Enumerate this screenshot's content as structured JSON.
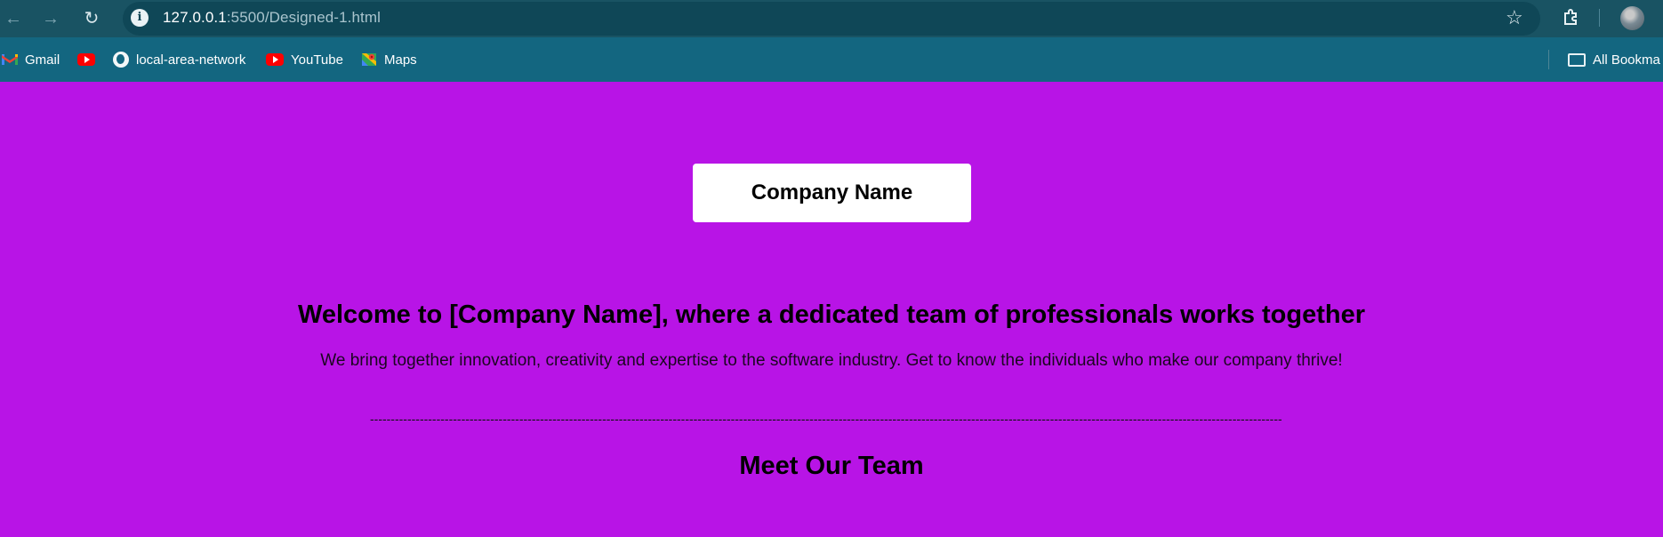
{
  "browser": {
    "url_host": "127.0.0.1",
    "url_path": ":5500/Designed-1.html",
    "nav": {
      "back_icon": "arrow-left-icon",
      "forward_icon": "arrow-right-icon",
      "reload_icon": "reload-icon"
    }
  },
  "bookmarks": {
    "items": [
      {
        "label": "Gmail",
        "icon": "gmail-icon"
      },
      {
        "label": "",
        "icon": "youtube-icon"
      },
      {
        "label": "local-area-network",
        "icon": "globe-icon"
      },
      {
        "label": "YouTube",
        "icon": "youtube-icon"
      },
      {
        "label": "Maps",
        "icon": "maps-icon"
      }
    ],
    "all_bookmarks": "All Bookma"
  },
  "page": {
    "company_box": "Company Name",
    "headline": "Welcome to [Company Name], where a dedicated team of professionals works together",
    "subline": "We bring together innovation, creativity and expertise to the software industry. Get to know the individuals who make our company thrive!",
    "divider": "----------------------------------------------------------------------------------------------------------------------------------------------------------------------------------------------------------------------------",
    "team_heading": "Meet Our Team"
  },
  "colors": {
    "page_bg": "#b814e6",
    "toolbar_bg": "#195363",
    "bookmarks_bg": "#136680"
  }
}
